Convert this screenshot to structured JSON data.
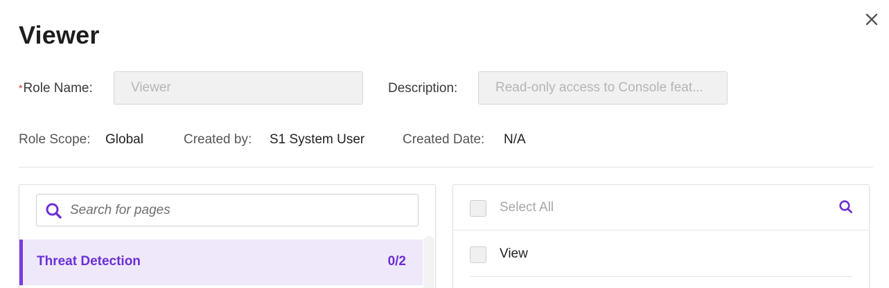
{
  "dialog": {
    "title": "Viewer",
    "close_icon": "close-icon"
  },
  "fields": {
    "role_name": {
      "required_mark": "*",
      "label": "Role Name:",
      "value": "Viewer"
    },
    "description": {
      "label": "Description:",
      "value": "Read-only access to Console feat..."
    }
  },
  "meta": {
    "role_scope": {
      "label": "Role Scope:",
      "value": "Global"
    },
    "created_by": {
      "label": "Created by:",
      "value": "S1 System User"
    },
    "created_date": {
      "label": "Created Date:",
      "value": "N/A"
    }
  },
  "pages_panel": {
    "search_placeholder": "Search for pages",
    "search_icon": "search-icon",
    "items": [
      {
        "label": "Threat Detection",
        "count": "0/2",
        "selected": true
      }
    ]
  },
  "permissions_panel": {
    "select_all_label": "Select All",
    "search_icon": "search-icon",
    "items": [
      {
        "label": "View",
        "checked": false
      }
    ]
  },
  "colors": {
    "accent": "#6b2fd6",
    "selected_bg": "#efe8fb",
    "required": "#d0302f"
  }
}
